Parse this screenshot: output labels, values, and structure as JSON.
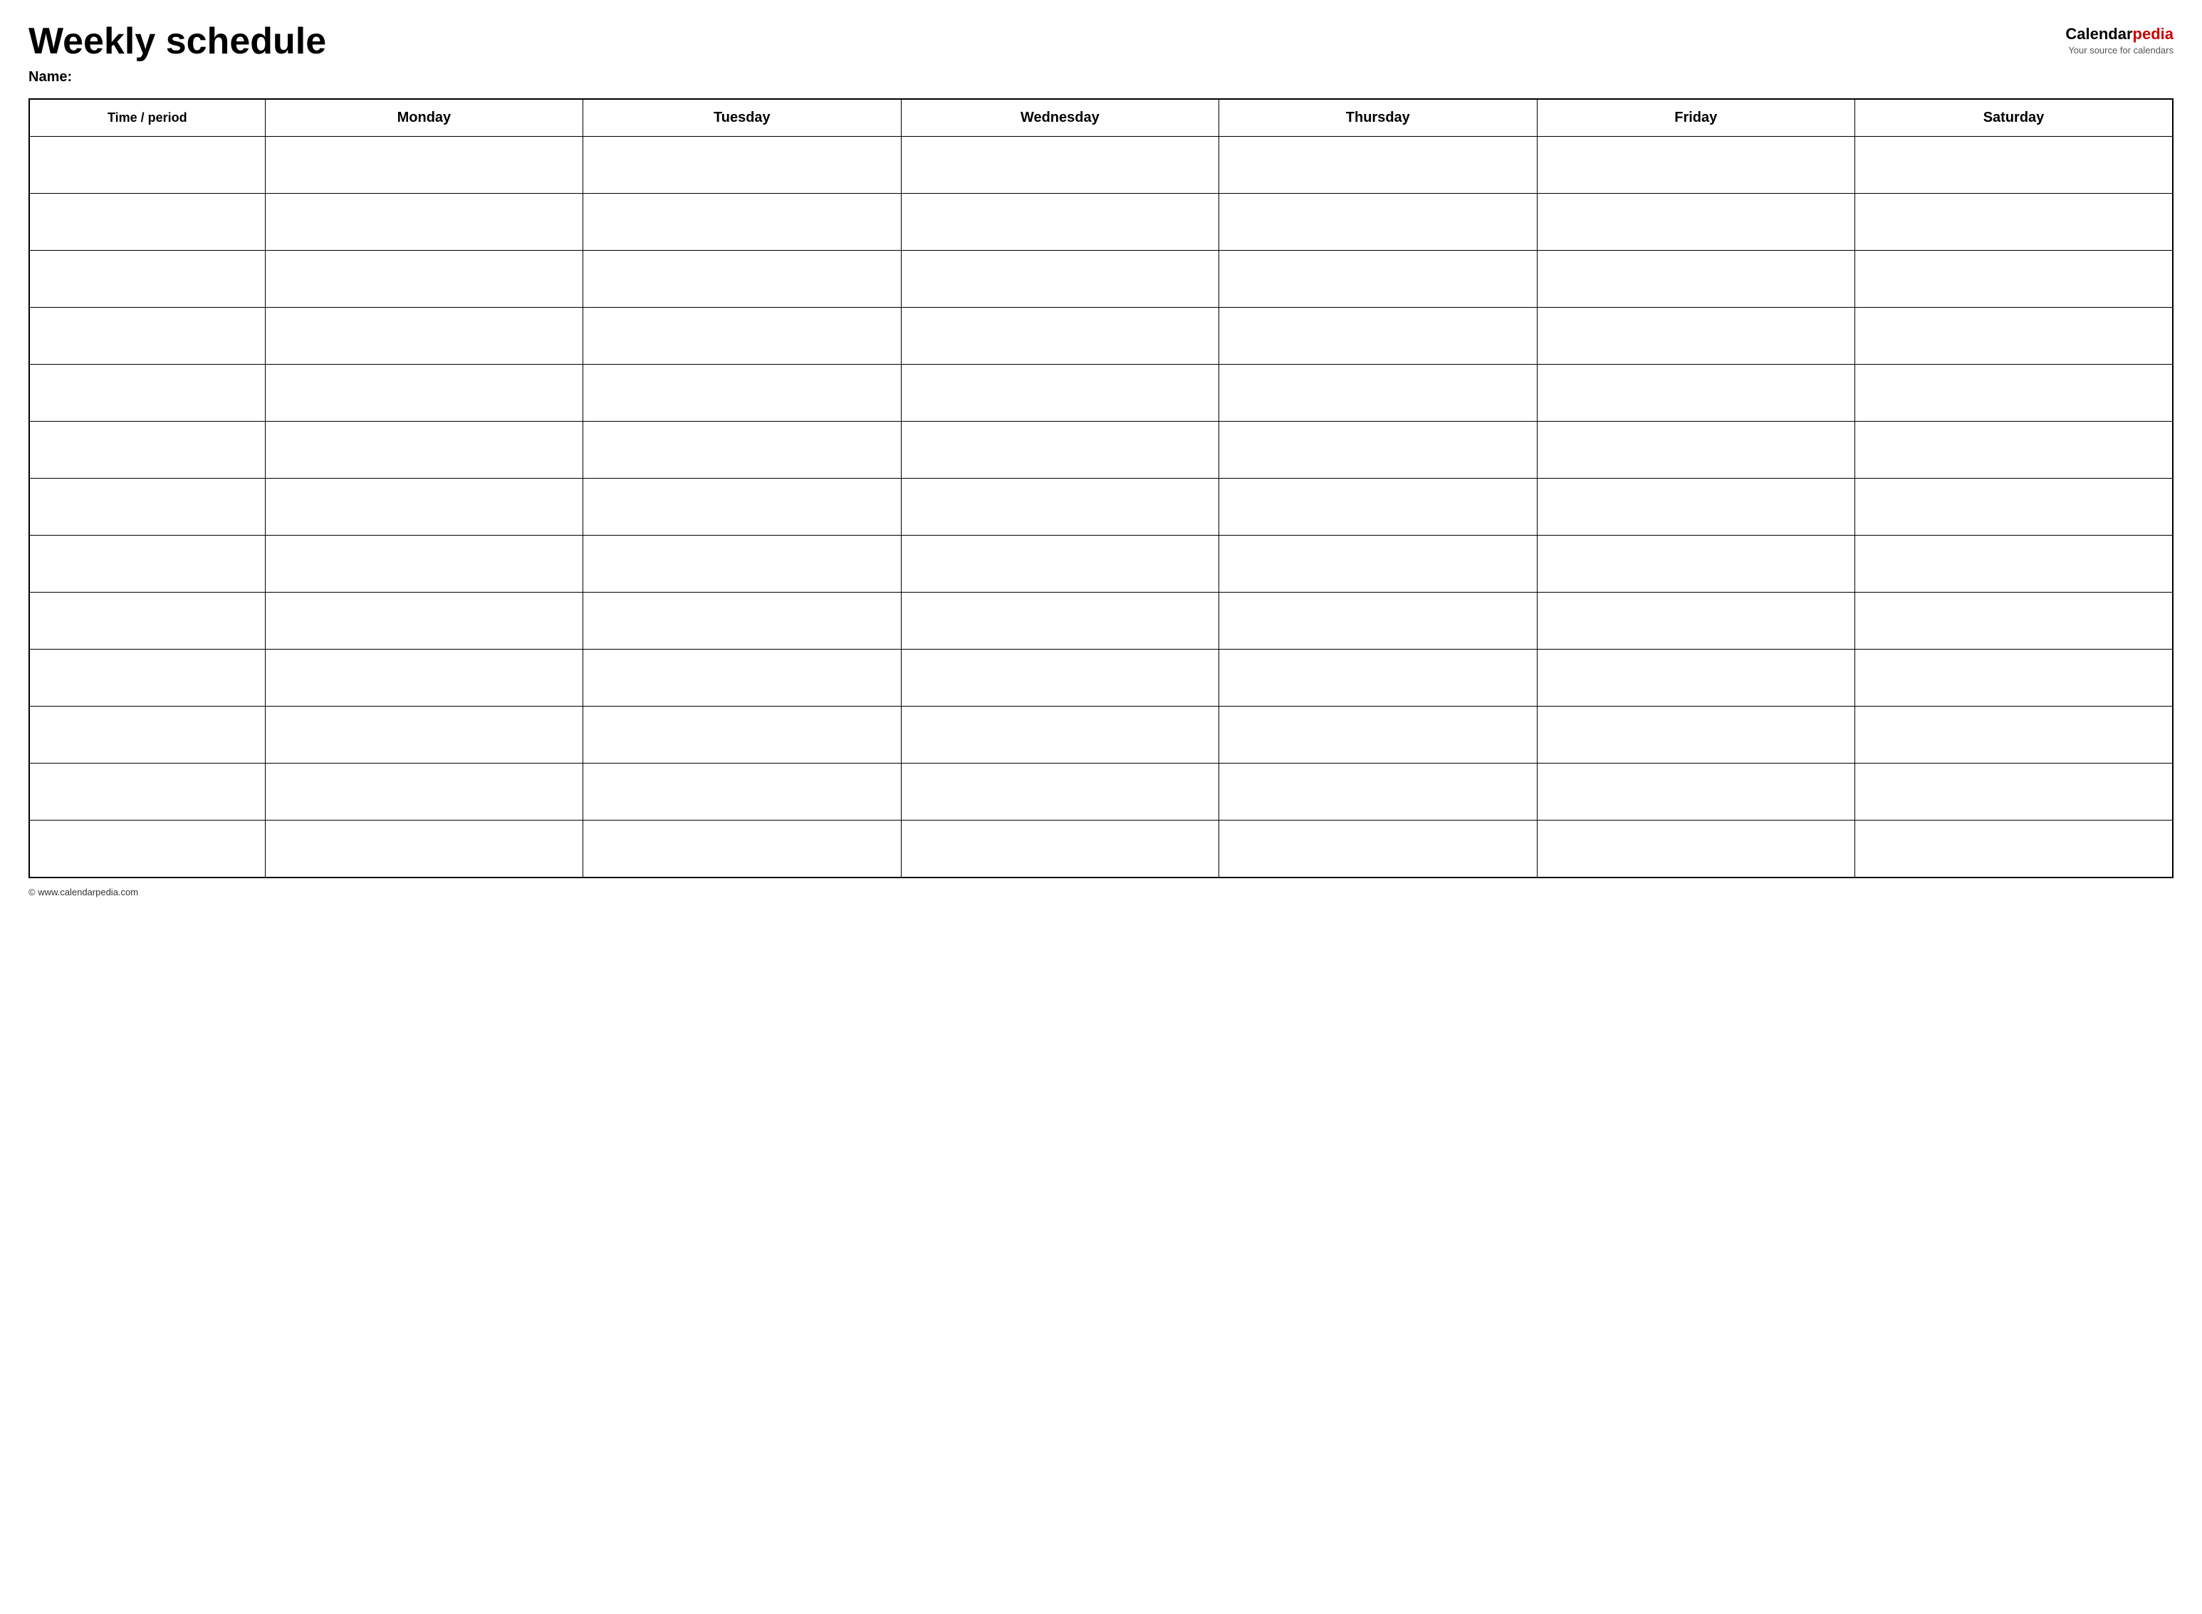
{
  "header": {
    "title": "Weekly schedule",
    "logo_calendar": "Calendar",
    "logo_pedia": "pedia",
    "logo_subtitle": "Your source for calendars",
    "name_label": "Name:"
  },
  "table": {
    "columns": [
      {
        "id": "time",
        "label": "Time / period"
      },
      {
        "id": "monday",
        "label": "Monday"
      },
      {
        "id": "tuesday",
        "label": "Tuesday"
      },
      {
        "id": "wednesday",
        "label": "Wednesday"
      },
      {
        "id": "thursday",
        "label": "Thursday"
      },
      {
        "id": "friday",
        "label": "Friday"
      },
      {
        "id": "saturday",
        "label": "Saturday"
      }
    ],
    "row_count": 13
  },
  "footer": {
    "text": "© www.calendarpedia.com"
  }
}
